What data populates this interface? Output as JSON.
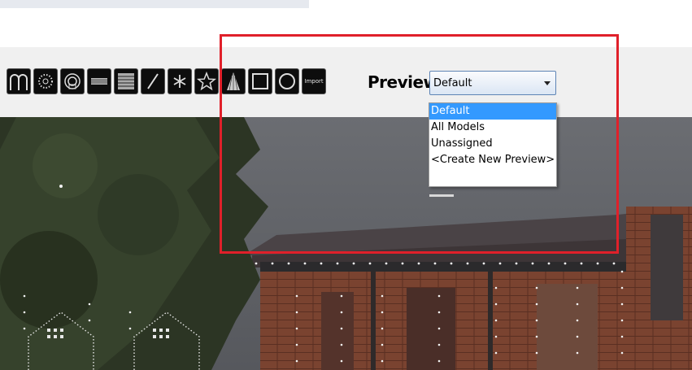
{
  "toolbar": {
    "tools": [
      {
        "name": "arches-tool",
        "icon": "arches-icon"
      },
      {
        "name": "circle-tool",
        "icon": "dotted-circle-icon"
      },
      {
        "name": "wreath-tool",
        "icon": "wreath-icon"
      },
      {
        "name": "matrix-tool",
        "icon": "matrix-icon"
      },
      {
        "name": "grid-tool",
        "icon": "grid-icon"
      },
      {
        "name": "line-tool",
        "icon": "line-icon"
      },
      {
        "name": "star-burst-tool",
        "icon": "asterisk-icon"
      },
      {
        "name": "star-tool",
        "icon": "star-icon"
      },
      {
        "name": "tree-tool",
        "icon": "tree-icon"
      },
      {
        "name": "square-tool",
        "icon": "square-icon"
      },
      {
        "name": "ellipse-tool",
        "icon": "ellipse-icon"
      },
      {
        "name": "import-tool",
        "icon": "import-icon",
        "label": "Import"
      }
    ]
  },
  "preview": {
    "label": "Preview:",
    "selected": "Default",
    "options": [
      "Default",
      "All Models",
      "Unassigned",
      "<Create New Preview>"
    ]
  },
  "colors": {
    "highlight": "#e0202a",
    "selection": "#3399ff"
  }
}
